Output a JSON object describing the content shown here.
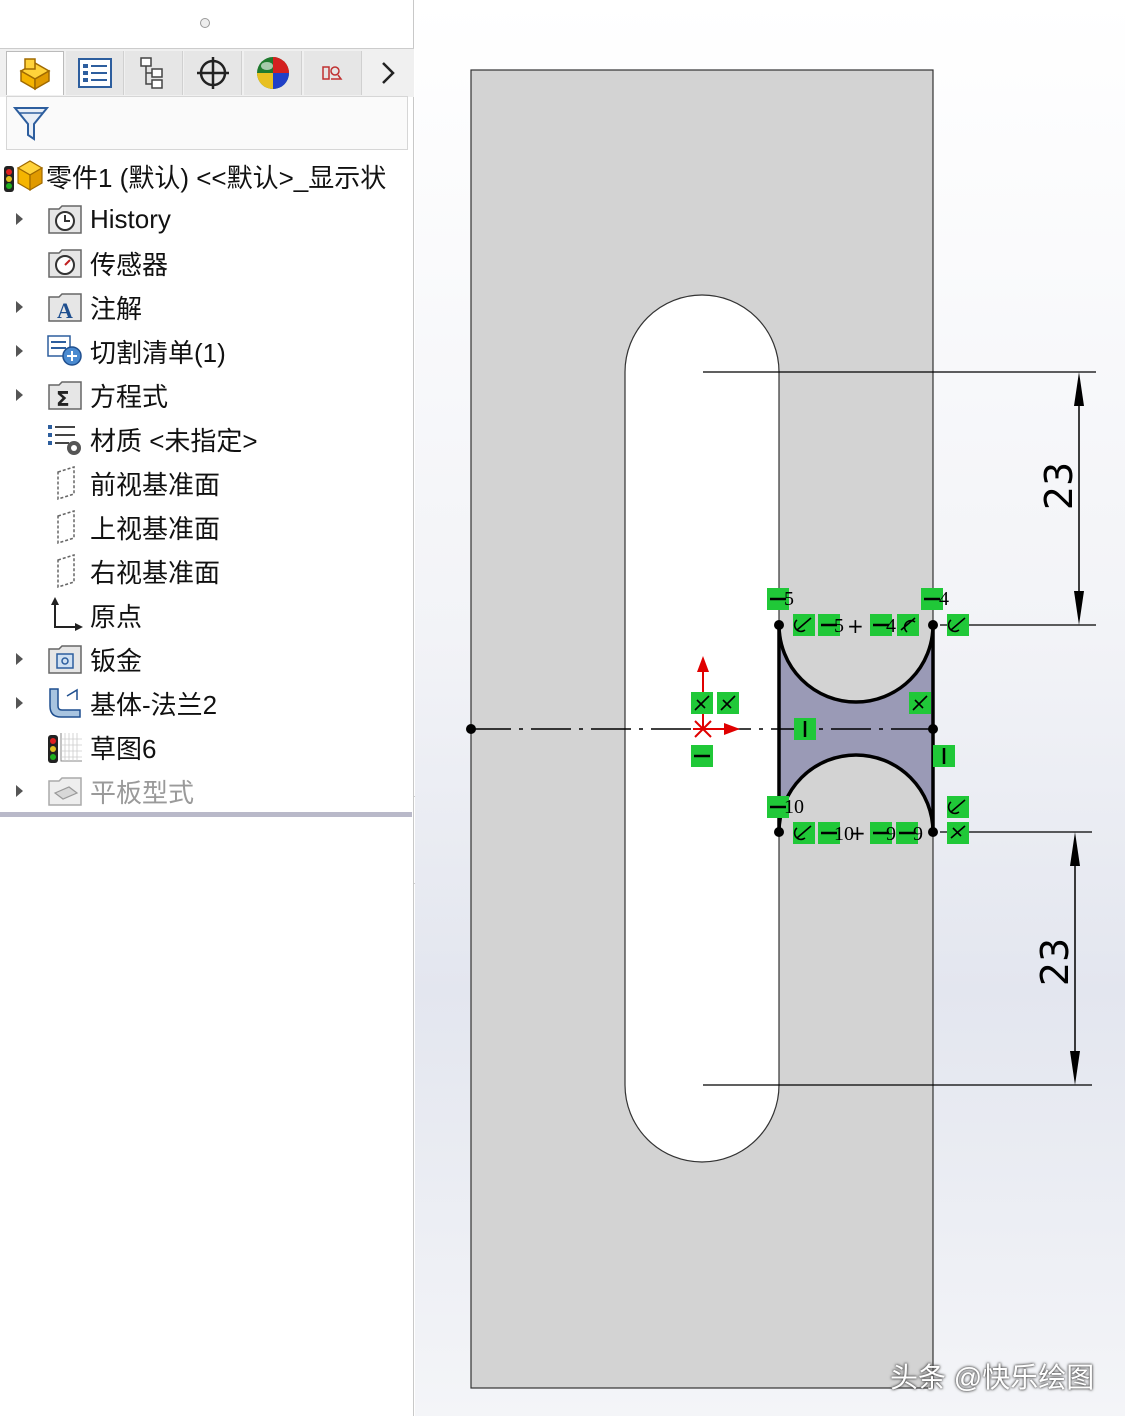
{
  "feature_tree": {
    "root": {
      "label": "零件1 (默认) <<默认>_显示状"
    },
    "items": [
      {
        "label": "History",
        "icon": "history-icon",
        "expandable": true
      },
      {
        "label": "传感器",
        "icon": "sensor-icon",
        "expandable": false
      },
      {
        "label": "注解",
        "icon": "annotation-icon",
        "expandable": true
      },
      {
        "label": "切割清单(1)",
        "icon": "cut-list-icon",
        "expandable": true
      },
      {
        "label": "方程式",
        "icon": "equation-icon",
        "expandable": true
      },
      {
        "label": "材质 <未指定>",
        "icon": "material-icon",
        "expandable": false
      },
      {
        "label": "前视基准面",
        "icon": "plane-icon",
        "expandable": false
      },
      {
        "label": "上视基准面",
        "icon": "plane-icon",
        "expandable": false
      },
      {
        "label": "右视基准面",
        "icon": "plane-icon",
        "expandable": false
      },
      {
        "label": "原点",
        "icon": "origin-icon",
        "expandable": false
      },
      {
        "label": "钣金",
        "icon": "sheet-metal-icon",
        "expandable": true
      },
      {
        "label": "基体-法兰2",
        "icon": "base-flange-icon",
        "expandable": true
      },
      {
        "label": "草图6",
        "icon": "sketch-icon",
        "expandable": false
      },
      {
        "label": "平板型式",
        "icon": "flat-pattern-icon",
        "expandable": true,
        "disabled": true
      }
    ]
  },
  "tabs": [
    "feature-manager-tab",
    "property-manager-tab",
    "configuration-manager-tab",
    "dimxpert-tab",
    "display-manager-tab",
    "cam-tab",
    "more-tabs-chevron"
  ],
  "canvas": {
    "dimensions": {
      "upper": "23",
      "lower": "23"
    },
    "relation_labels": {
      "top_left": "5",
      "top_right": "4",
      "top_mid_a": "5",
      "top_mid_b": "4",
      "bottom_left": "10",
      "bottom_mid_a": "10",
      "bottom_mid_b": "9",
      "bottom_mid_c": "9"
    },
    "colors": {
      "part_face": "#d3d3d3",
      "sketch_region": "#9898b4",
      "relation_badge": "#20c838",
      "origin_red": "#e00000"
    }
  },
  "watermark": "头条 @快乐绘图"
}
